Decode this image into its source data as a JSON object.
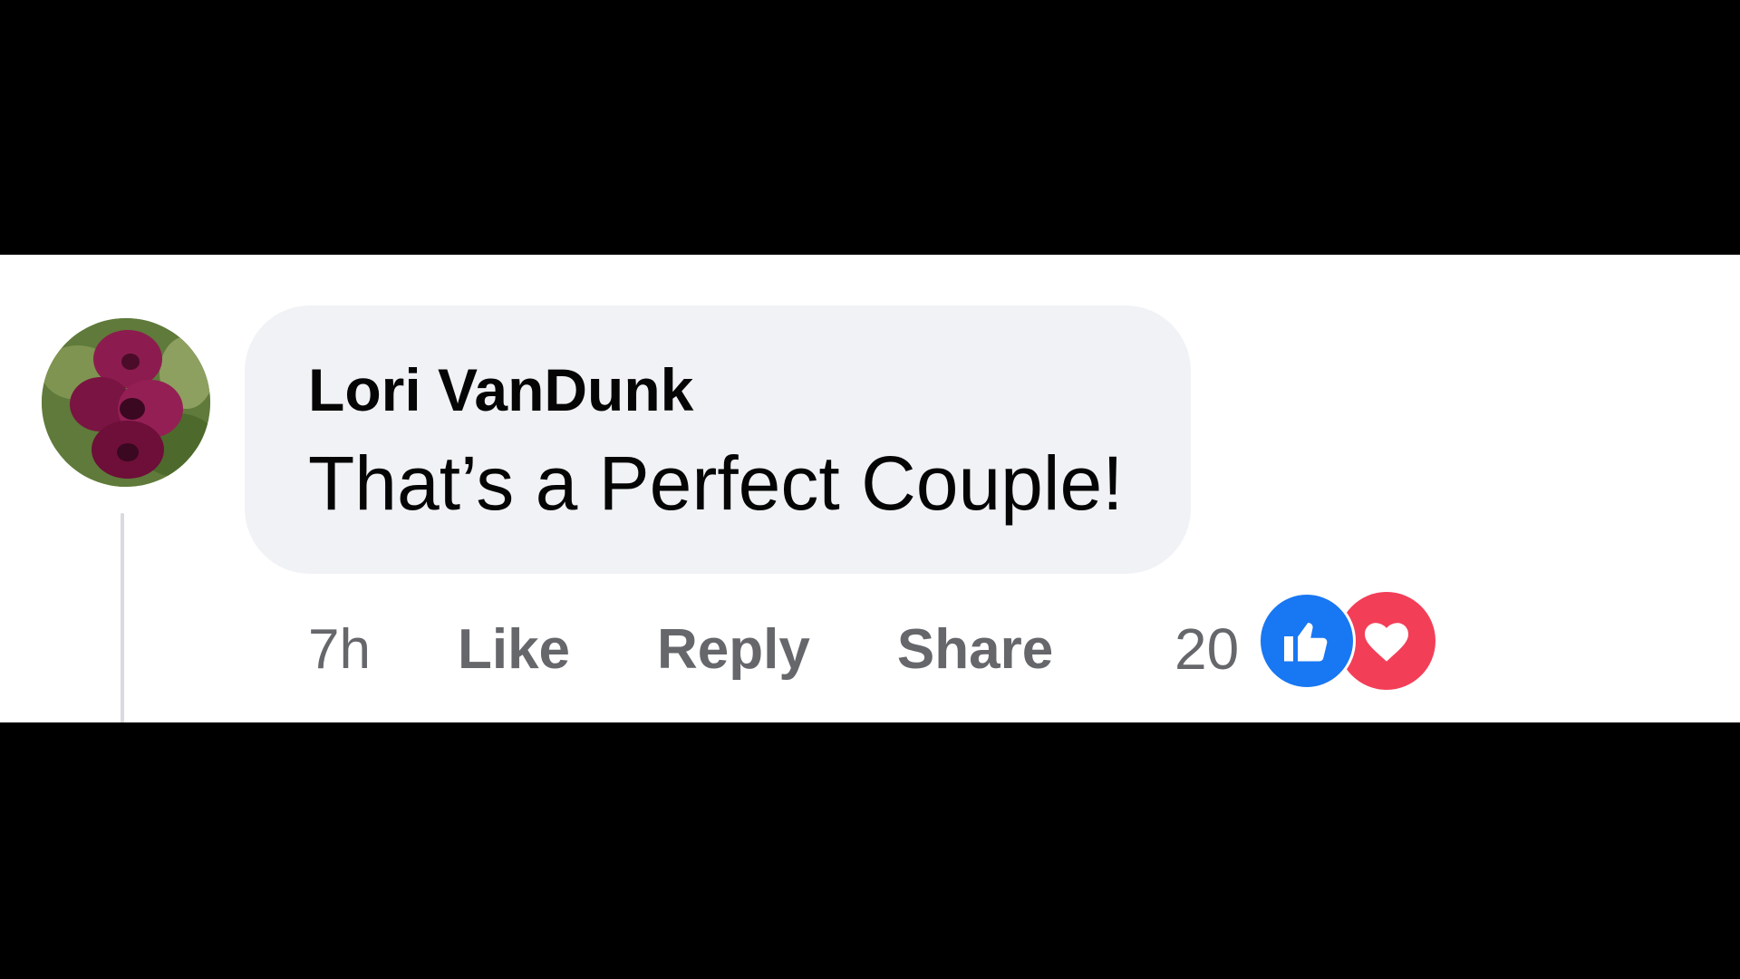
{
  "comment": {
    "author": "Lori VanDunk",
    "text": "That’s a Perfect Couple!",
    "timestamp": "7h",
    "actions": {
      "like": "Like",
      "reply": "Reply",
      "share": "Share"
    },
    "reaction_count": "20",
    "reactions": [
      "like-icon",
      "love-icon"
    ]
  },
  "colors": {
    "bubble_background": "#f0f2f5",
    "action_text": "#65676b",
    "like_blue": "#1877f2",
    "love_red": "#f33e58"
  }
}
